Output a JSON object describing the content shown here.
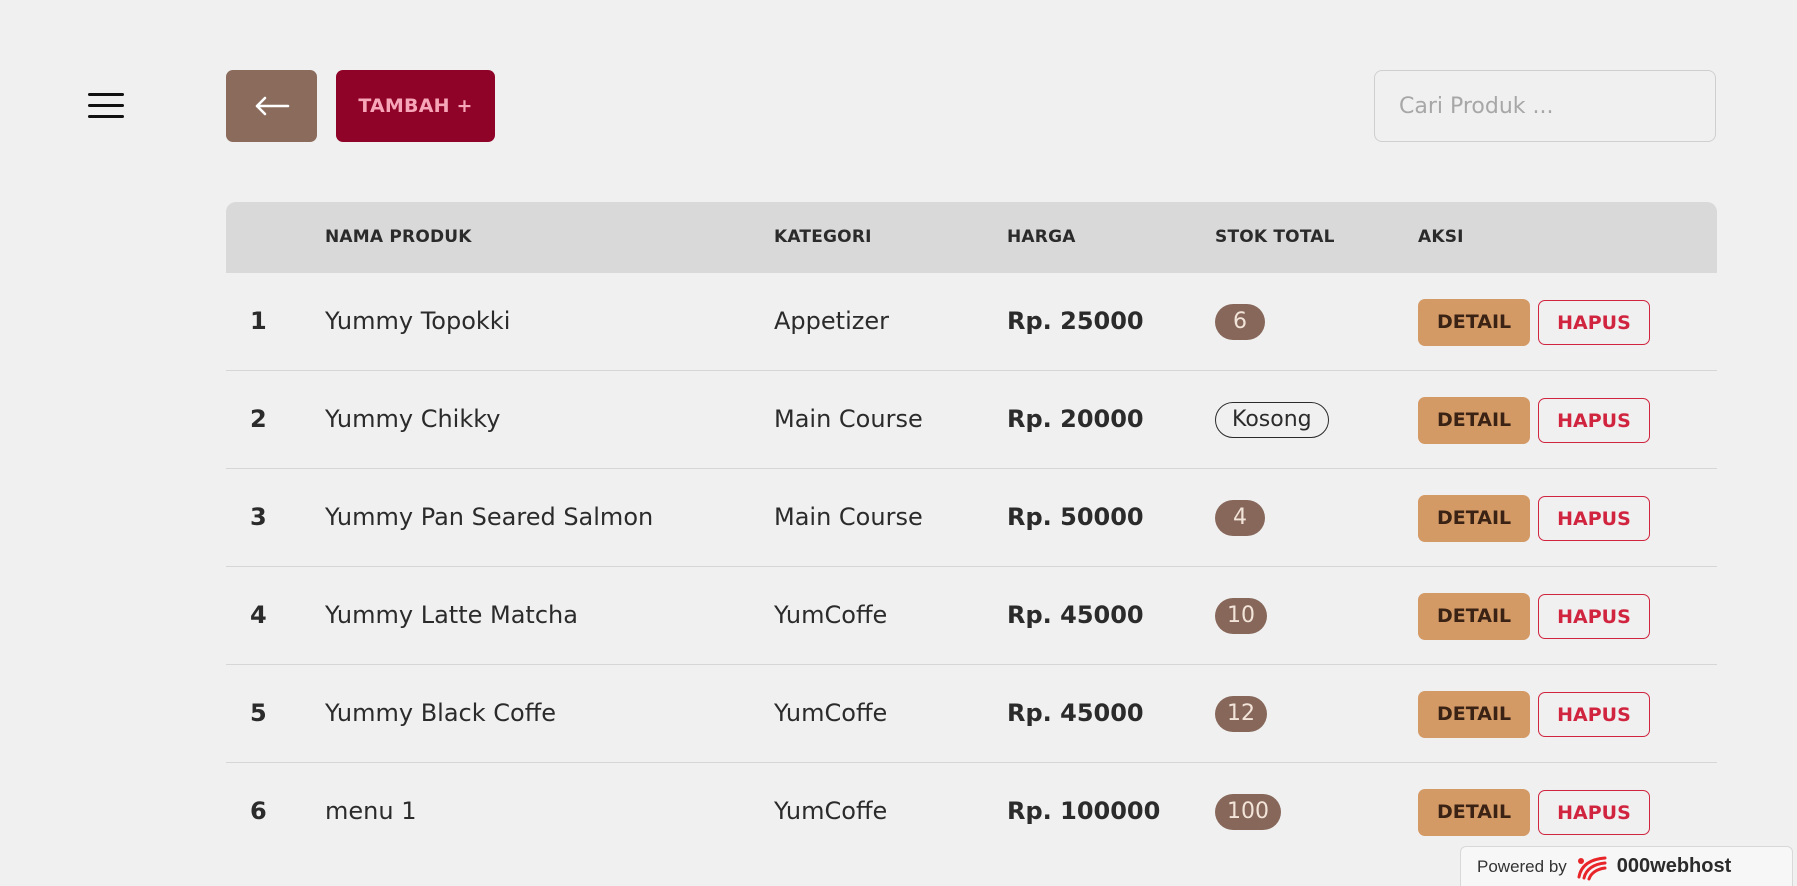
{
  "header": {
    "menu_icon": "hamburger-menu-icon",
    "back_icon": "arrow-left-icon",
    "add_label": "TAMBAH +",
    "search_placeholder": "Cari Produk ..."
  },
  "table": {
    "columns": [
      "",
      "NAMA PRODUK",
      "KATEGORI",
      "HARGA",
      "STOK TOTAL",
      "AKSI"
    ],
    "rows": [
      {
        "no": "1",
        "name": "Yummy Topokki",
        "category": "Appetizer",
        "price": "Rp. 25000",
        "stock": "6"
      },
      {
        "no": "2",
        "name": "Yummy Chikky",
        "category": "Main Course",
        "price": "Rp. 20000",
        "stock": "Kosong"
      },
      {
        "no": "3",
        "name": "Yummy Pan Seared Salmon",
        "category": "Main Course",
        "price": "Rp. 50000",
        "stock": "4"
      },
      {
        "no": "4",
        "name": "Yummy Latte Matcha",
        "category": "YumCoffe",
        "price": "Rp. 45000",
        "stock": "10"
      },
      {
        "no": "5",
        "name": "Yummy Black Coffe",
        "category": "YumCoffe",
        "price": "Rp. 45000",
        "stock": "12"
      },
      {
        "no": "6",
        "name": "menu 1",
        "category": "YumCoffe",
        "price": "Rp. 100000",
        "stock": "100"
      }
    ],
    "detail_label": "DETAIL",
    "delete_label": "HAPUS"
  },
  "footer": {
    "powered_text": "Powered by",
    "brand": "000webhost",
    "brand_icon": "000webhost-logo-icon"
  },
  "colors": {
    "background": "#f0f0f0",
    "back_button": "#8a6b5c",
    "add_button": "#8f0328",
    "add_text": "#f6a6b8",
    "header_row": "#d9d9d9",
    "stock_badge": "#86675a",
    "detail_button": "#d49a66",
    "delete_border": "#d0243f"
  }
}
